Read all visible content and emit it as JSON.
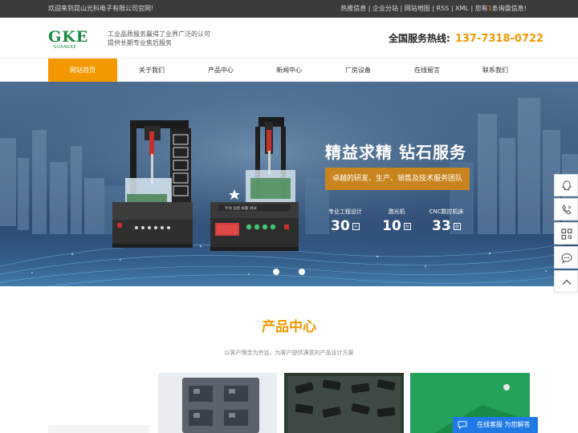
{
  "topbar": {
    "welcome": "欢迎来到昆山光科电子有限公司官网!",
    "links": "热推信息 | 企业分站 | 网站地图 | RSS | XML | 您有",
    "links_highlight": "1",
    "links_tail": "条询盘信息!"
  },
  "header": {
    "logo_mark": "GKE",
    "logo_sub": "GUANGKE",
    "slogan_line1": "工业品质服务赢得了业界广泛的认可",
    "slogan_line2": "提供长期专业售后服务",
    "hotline_label": "全国服务热线:",
    "hotline_number": "137-7318-0722"
  },
  "nav": {
    "items": [
      {
        "label": "网站首页"
      },
      {
        "label": "关于我们"
      },
      {
        "label": "产品中心"
      },
      {
        "label": "新闻中心"
      },
      {
        "label": "厂房设备"
      },
      {
        "label": "在线留言"
      },
      {
        "label": "联系我们"
      }
    ]
  },
  "banner": {
    "title": "精益求精 钻石服务",
    "subtitle": "卓越的研发、生产、销售及技术服务团队",
    "device_panel_text": "手动 远程 报警 测试",
    "stats": [
      {
        "label": "专业工程设计",
        "value": "30",
        "unit": "人"
      },
      {
        "label": "激光机",
        "value": "10",
        "unit": "台"
      },
      {
        "label": "CNC数控机床",
        "value": "33",
        "unit": "台"
      }
    ]
  },
  "products": {
    "title": "产品中心",
    "subtitle": "以客户理念为宗旨，为客户提供满意的产品设计方案"
  },
  "chat": {
    "label": "在线客服 为您解答"
  },
  "colors": {
    "accent": "#f39800",
    "topbar": "#3b3b3b",
    "logo": "#1a8b45",
    "chat": "#1f7ae6"
  }
}
